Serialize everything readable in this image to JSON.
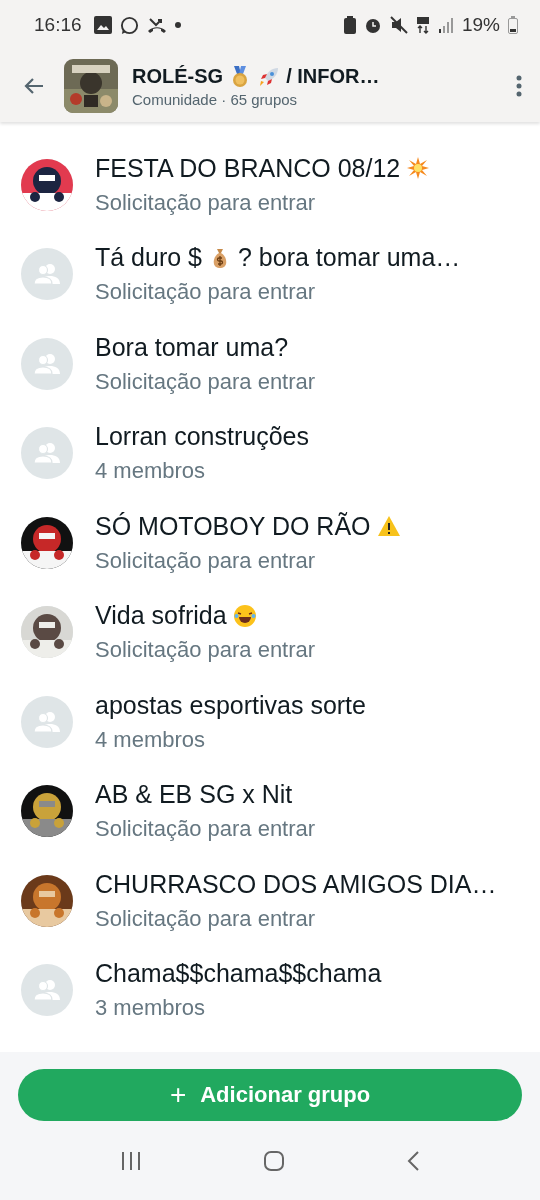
{
  "status_bar": {
    "time": "16:16",
    "battery": "19%"
  },
  "header": {
    "title": [
      {
        "kind": "text",
        "text": "ROLÉ-SG"
      },
      {
        "kind": "medal"
      },
      {
        "kind": "rocket"
      },
      {
        "kind": "text",
        "text": "/ INFOR…"
      }
    ],
    "subtitle": "Comunidade · 65 grupos"
  },
  "groups": [
    {
      "avatar": {
        "kind": "picture"
      },
      "title": [
        {
          "kind": "text",
          "text": "FESTA DO BRANCO 08/12"
        },
        {
          "kind": "explosion"
        }
      ],
      "subtitle": "Solicitação para entrar"
    },
    {
      "avatar": {
        "kind": "default"
      },
      "title": [
        {
          "kind": "text",
          "text": "Tá duro $"
        },
        {
          "kind": "money-bag"
        },
        {
          "kind": "text",
          "text": "? bora tomar uma…"
        }
      ],
      "subtitle": "Solicitação para entrar"
    },
    {
      "avatar": {
        "kind": "default"
      },
      "title": [
        {
          "kind": "text",
          "text": "Bora tomar uma?"
        }
      ],
      "subtitle": "Solicitação para entrar"
    },
    {
      "avatar": {
        "kind": "default"
      },
      "title": [
        {
          "kind": "text",
          "text": "Lorran construções"
        }
      ],
      "subtitle": "4 membros"
    },
    {
      "avatar": {
        "kind": "picture"
      },
      "title": [
        {
          "kind": "text",
          "text": "SÓ MOTOBOY DO RÃO"
        },
        {
          "kind": "warning"
        }
      ],
      "subtitle": "Solicitação para entrar"
    },
    {
      "avatar": {
        "kind": "picture"
      },
      "title": [
        {
          "kind": "text",
          "text": "Vida sofrida"
        },
        {
          "kind": "laughing"
        }
      ],
      "subtitle": "Solicitação para entrar"
    },
    {
      "avatar": {
        "kind": "default"
      },
      "title": [
        {
          "kind": "text",
          "text": "apostas esportivas sorte"
        }
      ],
      "subtitle": "4 membros"
    },
    {
      "avatar": {
        "kind": "picture"
      },
      "title": [
        {
          "kind": "text",
          "text": "AB & EB SG x Nit"
        }
      ],
      "subtitle": "Solicitação para entrar"
    },
    {
      "avatar": {
        "kind": "picture"
      },
      "title": [
        {
          "kind": "text",
          "text": "CHURRASCO DOS AMIGOS DIA…"
        }
      ],
      "subtitle": "Solicitação para entrar"
    },
    {
      "avatar": {
        "kind": "default"
      },
      "title": [
        {
          "kind": "text",
          "text": "Chama$$chama$$chama"
        }
      ],
      "subtitle": "3 membros"
    }
  ],
  "add_button": {
    "icon": "+",
    "label": "Adicionar grupo"
  }
}
